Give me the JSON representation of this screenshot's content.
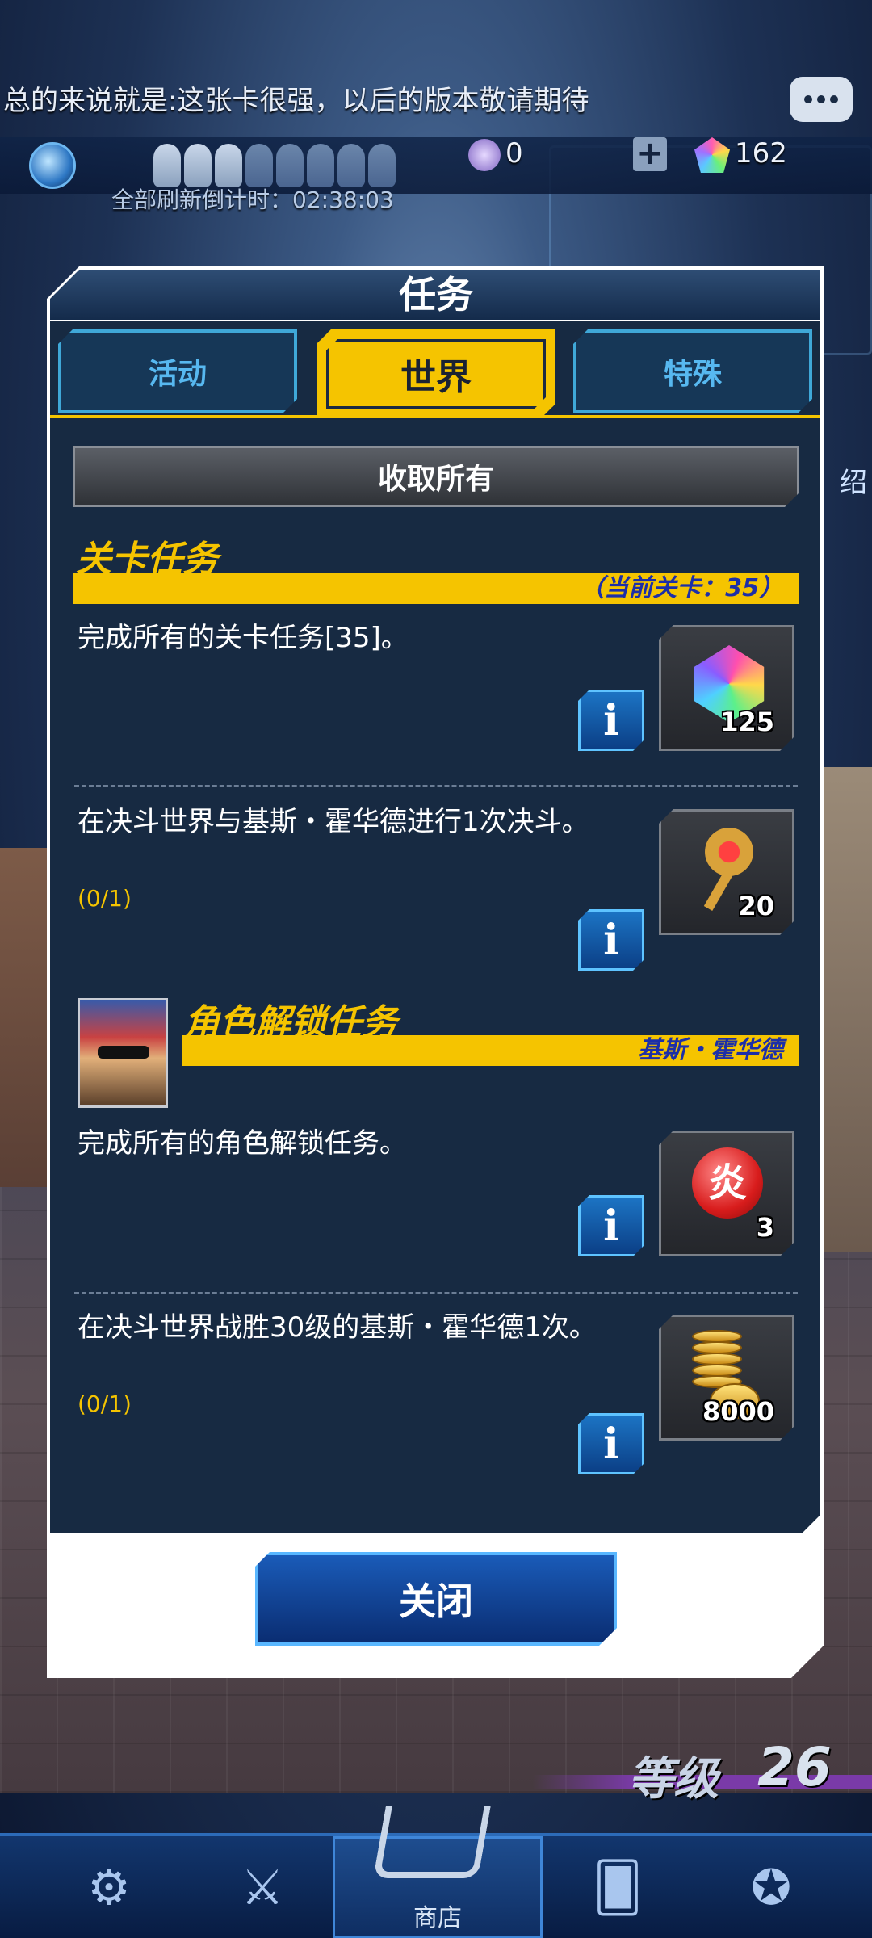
{
  "ticker": "总的来说就是:这张卡很强，以后的版本敬请期待",
  "resources": {
    "orbs": "0",
    "gems": "162"
  },
  "refresh_timer": "全部刷新倒计时：02:38:03",
  "side_label": "绍",
  "dialog": {
    "title": "任务",
    "tabs": [
      {
        "label": "活动",
        "active": false
      },
      {
        "label": "世界",
        "active": true
      },
      {
        "label": "特殊",
        "active": false
      }
    ],
    "claim_all": "收取所有",
    "stage_section": {
      "title": "关卡任务",
      "bar_text": "（当前关卡：35）",
      "quests": [
        {
          "text": "完成所有的关卡任务[35]。",
          "progress": "",
          "reward_count": "125",
          "reward_icon": "rainbow-crystal-icon"
        },
        {
          "text": "在决斗世界与基斯・霍华德进行1次决斗。",
          "progress": "(0/1)",
          "reward_count": "20",
          "reward_icon": "key-icon"
        }
      ]
    },
    "unlock_section": {
      "title": "角色解锁任务",
      "bar_text": "基斯・霍华德",
      "quests": [
        {
          "text": "完成所有的角色解锁任务。",
          "progress": "",
          "reward_count": "3",
          "reward_icon": "fire-orb-icon",
          "reward_glyph": "炎"
        },
        {
          "text": "在决斗世界战胜30级的基斯・霍华德1次。",
          "progress": "(0/1)",
          "reward_count": "8000",
          "reward_icon": "gold-coins-icon"
        }
      ]
    },
    "info_glyph": "i",
    "close": "关闭"
  },
  "level": {
    "label": "等级",
    "value": "26"
  },
  "bottom_nav": {
    "shop_label": "商店"
  },
  "colors": {
    "accent": "#f5c400",
    "panel": "#172a42",
    "info_blue": "#1c74c4",
    "bar_text": "#1d2fa8"
  }
}
